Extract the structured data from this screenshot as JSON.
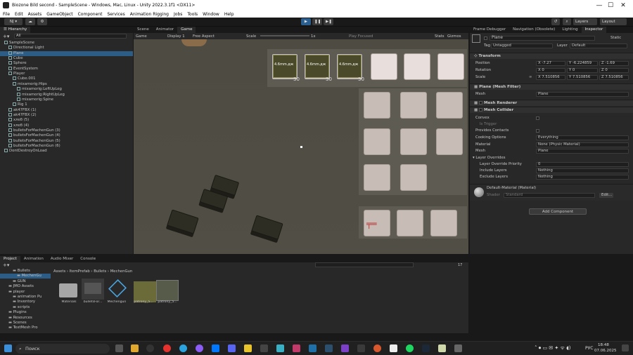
{
  "window": {
    "title": "Biozone Bild second - SampleScene - Windows, Mac, Linux - Unity 2022.3.1f1 <DX11>",
    "minimize": "—",
    "maximize": "☐",
    "close": "✕"
  },
  "menu": [
    "File",
    "Edit",
    "Assets",
    "GameObject",
    "Component",
    "Services",
    "Animation Rigging",
    "Jobs",
    "Tools",
    "Window",
    "Help"
  ],
  "toolbar": {
    "account": "NJ ▾",
    "layers": "Layers",
    "layout": "Layout"
  },
  "hierarchy": {
    "tab": "Hierarchy",
    "search_placeholder": "All",
    "items": [
      {
        "label": "SampleScene",
        "depth": 0
      },
      {
        "label": "Directional Light",
        "depth": 1
      },
      {
        "label": "Plane",
        "depth": 1,
        "selected": true
      },
      {
        "label": "Cube",
        "depth": 1
      },
      {
        "label": "Sphere",
        "depth": 1
      },
      {
        "label": "EventSystem",
        "depth": 1
      },
      {
        "label": "Player",
        "depth": 1
      },
      {
        "label": "Cube.001",
        "depth": 2
      },
      {
        "label": "mixamorig:Hips",
        "depth": 2
      },
      {
        "label": "mixamorig:LeftUpLeg",
        "depth": 3
      },
      {
        "label": "mixamorig:RightUpLeg",
        "depth": 3
      },
      {
        "label": "mixamorig:Spine",
        "depth": 3
      },
      {
        "label": "Rig 1",
        "depth": 2
      },
      {
        "label": "ak47FBX (1)",
        "depth": 1
      },
      {
        "label": "ak47FBX (2)",
        "depth": 1
      },
      {
        "label": "хлеб (5)",
        "depth": 1
      },
      {
        "label": "хлеб (4)",
        "depth": 1
      },
      {
        "label": "bulletsForMachenGun (3)",
        "depth": 1
      },
      {
        "label": "bulletsForMachenGun (4)",
        "depth": 1
      },
      {
        "label": "bulletsForMachenGun (5)",
        "depth": 1
      },
      {
        "label": "bulletsForMachenGun (6)",
        "depth": 1
      },
      {
        "label": "DontDestroyOnLoad",
        "depth": 0
      }
    ]
  },
  "scene": {
    "tabs": [
      "Scene",
      "Animator",
      "Game"
    ],
    "game_dropdown": "Game",
    "display": "Display 1",
    "aspect": "Free Aspect",
    "scale_label": "Scale",
    "scale_value": "1x",
    "play_focused": "Play Focused",
    "stats": "Stats",
    "gizmos": "Gizmos",
    "ammo_counts": [
      "30",
      "30",
      "30"
    ],
    "ammo_label": "4.6mm.дж"
  },
  "inspector": {
    "tabs": [
      "Frame Debugger",
      "Navigation (Obsolete)",
      "Lighting",
      "Inspector"
    ],
    "object_name": "Plane",
    "static": "Static",
    "tag_label": "Tag",
    "tag_value": "Untagged",
    "layer_label": "Layer",
    "layer_value": "Default",
    "transform": {
      "title": "Transform",
      "position": {
        "label": "Position",
        "x": "-7.27",
        "y": "-6.224859",
        "z": "-1.69"
      },
      "rotation": {
        "label": "Rotation",
        "x": "0",
        "y": "0",
        "z": "0"
      },
      "scale": {
        "label": "Scale",
        "x": "7.510856",
        "y": "7.510856",
        "z": "7.510856"
      }
    },
    "mesh_filter": {
      "title": "Plane (Mesh Filter)",
      "mesh_label": "Mesh",
      "mesh_value": "Plane"
    },
    "mesh_renderer": {
      "title": "Mesh Renderer"
    },
    "mesh_collider": {
      "title": "Mesh Collider",
      "convex": "Convex",
      "is_trigger": "Is Trigger",
      "provides_contacts": "Provides Contacts",
      "cooking_label": "Cooking Options",
      "cooking_value": "Everything",
      "material_label": "Material",
      "material_value": "None (Physic Material)",
      "mesh_label": "Mesh",
      "mesh_value": "Plane"
    },
    "layer_overrides": {
      "title": "Layer Overrides",
      "priority_label": "Layer Override Priority",
      "priority_value": "0",
      "include_label": "Include Layers",
      "include_value": "Nothing",
      "exclude_label": "Exclude Layers",
      "exclude_value": "Nothing"
    },
    "material": {
      "title": "Default-Material (Material)",
      "shader_label": "Shader",
      "shader_value": "Standard",
      "edit": "Edit..."
    },
    "add_component": "Add Component"
  },
  "project": {
    "tabs": [
      "Project",
      "Animation",
      "Audio Mixer",
      "Console"
    ],
    "breadcrumb": [
      "Assets",
      "ItemPrefab",
      "Bullets",
      "MechenGun"
    ],
    "folders": [
      {
        "label": "Bullets",
        "depth": 1
      },
      {
        "label": "MechenGu",
        "depth": 2,
        "selected": true
      },
      {
        "label": "GUN",
        "depth": 1
      },
      {
        "label": "JMO Assets",
        "depth": 0
      },
      {
        "label": "player",
        "depth": 0
      },
      {
        "label": "animation Pu",
        "depth": 1
      },
      {
        "label": "Inventory",
        "depth": 1
      },
      {
        "label": "scripts",
        "depth": 1
      },
      {
        "label": "Plugins",
        "depth": 0
      },
      {
        "label": "Resources",
        "depth": 0
      },
      {
        "label": "Scenes",
        "depth": 0
      },
      {
        "label": "TextMesh Pro",
        "depth": 0
      }
    ],
    "assets": [
      "Materials",
      "bulletsFor...",
      "Mechengun",
      "patrony_5...",
      "patrony_5..."
    ],
    "asset_count": "17"
  },
  "taskbar": {
    "search_placeholder": "Поиск",
    "language": "РУС",
    "time": "18:48",
    "date": "07.06.2025"
  },
  "colors": {
    "selection": "#2c5d87",
    "play": "#2a5f8f",
    "slot": "#c8bcb6"
  }
}
